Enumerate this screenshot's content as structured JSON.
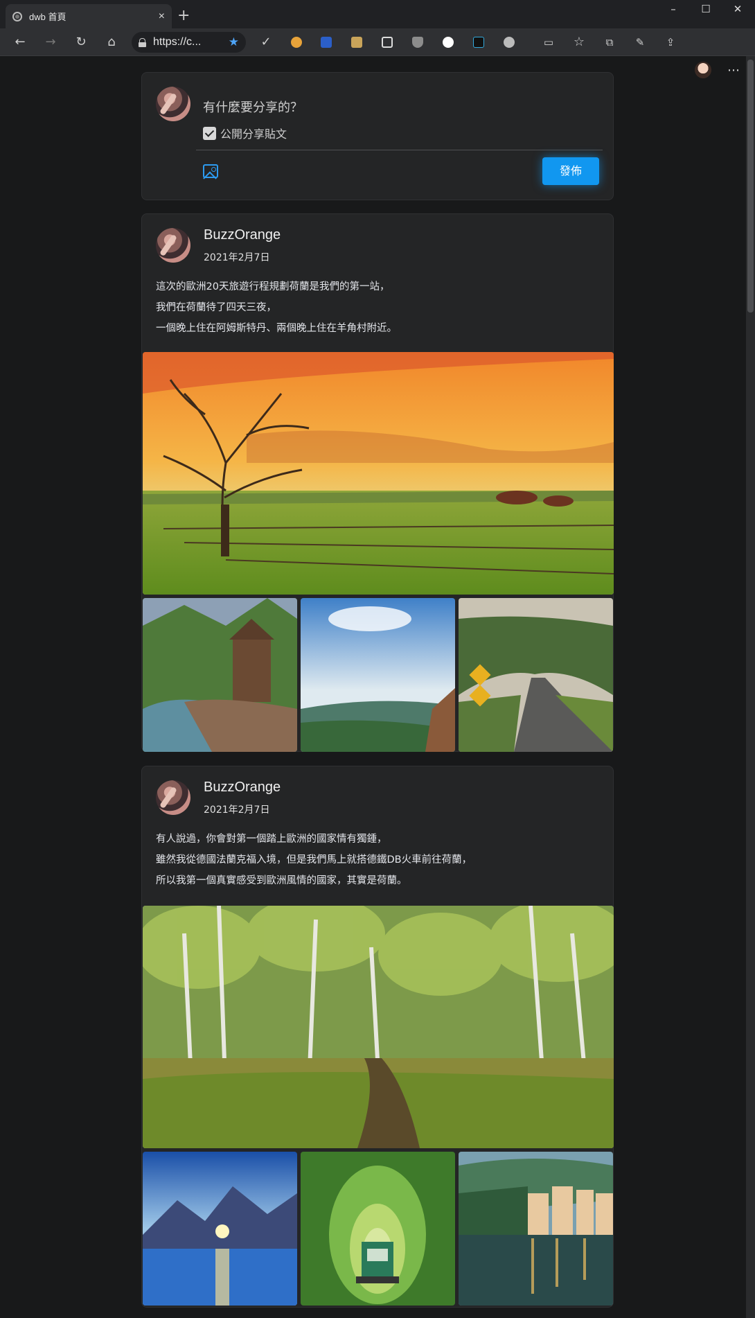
{
  "browser": {
    "tab_title": "dwb 首頁",
    "tab_close": "×",
    "new_tab": "+",
    "url": "https://c...",
    "window_controls": [
      "–",
      "☐",
      "✕"
    ],
    "more": "⋯"
  },
  "composer": {
    "placeholder": "有什麼要分享的？",
    "public_label": "公開分享貼文",
    "public_checked": true,
    "submit_label": "發佈"
  },
  "posts": [
    {
      "author": "BuzzOrange",
      "date": "2021年2月7日",
      "lines": [
        "這次的歐洲20天旅遊行程規劃荷蘭是我們的第一站，",
        "我們在荷蘭待了四天三夜，",
        "一個晚上住在阿姆斯特丹、兩個晚上住在羊角村附近。"
      ],
      "images": [
        "sunset-vineyard-tree",
        "mountain-mill-river",
        "sky-valley-cliff",
        "tree-tunnel-road"
      ]
    },
    {
      "author": "BuzzOrange",
      "date": "2021年2月7日",
      "lines": [
        "有人說過，你會對第一個踏上歐洲的國家情有獨鍾，",
        "雖然我從德國法蘭克福入境，但是我們馬上就搭德鐵DB火車前往荷蘭，",
        "所以我第一個真實感受到歐洲風情的國家，其實是荷蘭。"
      ],
      "images": [
        "birch-forest-path",
        "mountain-lake-sunrise",
        "green-train-tunnel",
        "lakeside-village"
      ]
    }
  ],
  "colors": {
    "page_bg": "#18191a",
    "card_bg": "#242526",
    "accent": "#1197f0"
  }
}
